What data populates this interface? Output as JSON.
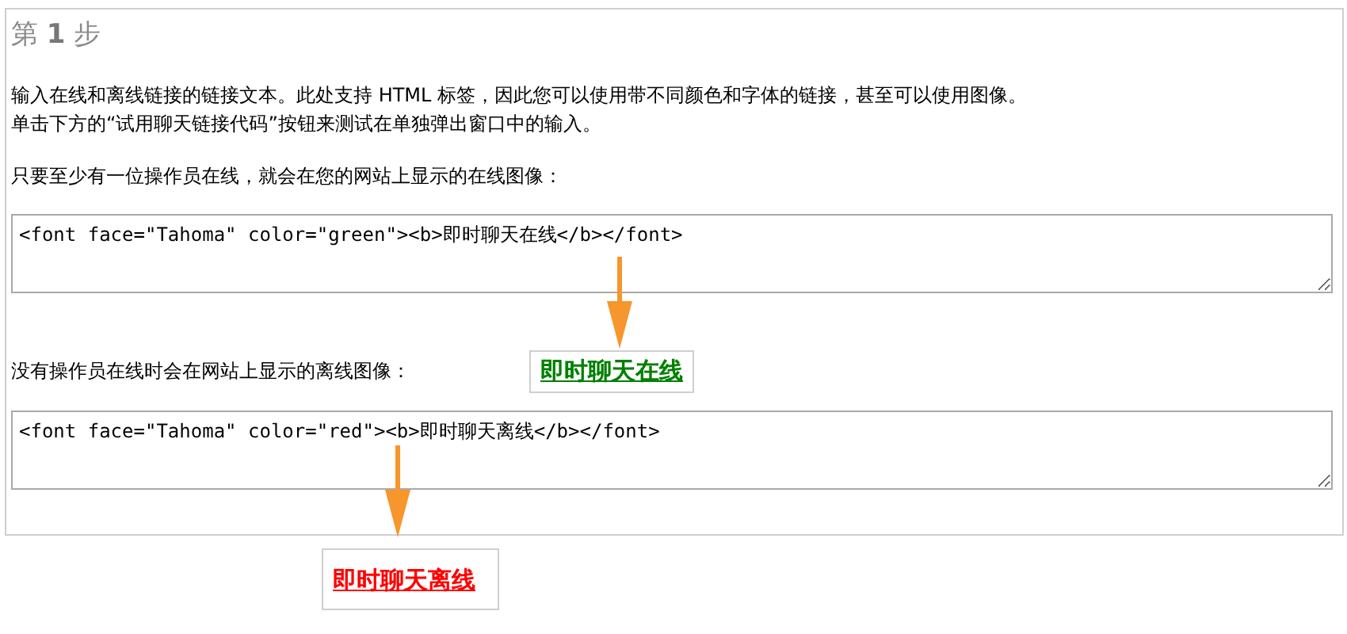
{
  "step_title": "第 **1** 步",
  "intro": [
    "输入在线和离线链接的链接文本。此处支持 HTML 标签，因此您可以使用带不同颜色和字体的链接，甚至可以使用图像。",
    "单击下方的“试用聊天链接代码”按钮来测试在单独弹出窗口中的输入。"
  ],
  "sections": [
    {
      "label": "只要至少有一位操作员在线，就会在您的网站上显示的在线图像：",
      "code": "<font face=\"Tahoma\" color=\"green\"><b>即时聊天在线</b></font>",
      "preview": {
        "text": "即时聊天在线",
        "color": "#008000"
      }
    },
    {
      "label": "没有操作员在线时会在网站上显示的离线图像：",
      "code": "<font face=\"Tahoma\" color=\"red\"><b>即时聊天离线</b></font>",
      "preview": {
        "text": "即时聊天离线",
        "color": "#ff0000"
      }
    }
  ]
}
